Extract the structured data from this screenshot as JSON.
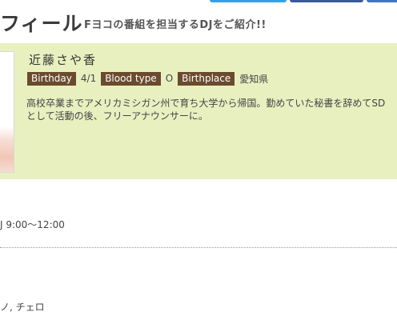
{
  "header": {
    "title": "フィール",
    "subtitle": "Fヨコの番組を担当するDJをご紹介!!"
  },
  "profile": {
    "name": "近藤さや香",
    "birthday_label": "Birthday",
    "birthday_value": "4/1",
    "blood_label": "Blood type",
    "blood_value": "O",
    "birthplace_label": "Birthplace",
    "birthplace_value": "愛知県",
    "bio_line1": "高校卒業までアメリカミシガン州で育ち大学から帰国。勤めていた秘書を辞めてSD",
    "bio_line2": "として活動の後、フリーアナウンサーに。"
  },
  "schedule": {
    "time": "J 9:00〜12:00"
  },
  "instruments": {
    "text": "ノ, チェロ"
  },
  "colors": {
    "profile_bg": "#e8f0c0",
    "tag_bg": "#6b4a2e",
    "twitter_blue": "#2ea2e8",
    "facebook_blue": "#3a5a98"
  }
}
